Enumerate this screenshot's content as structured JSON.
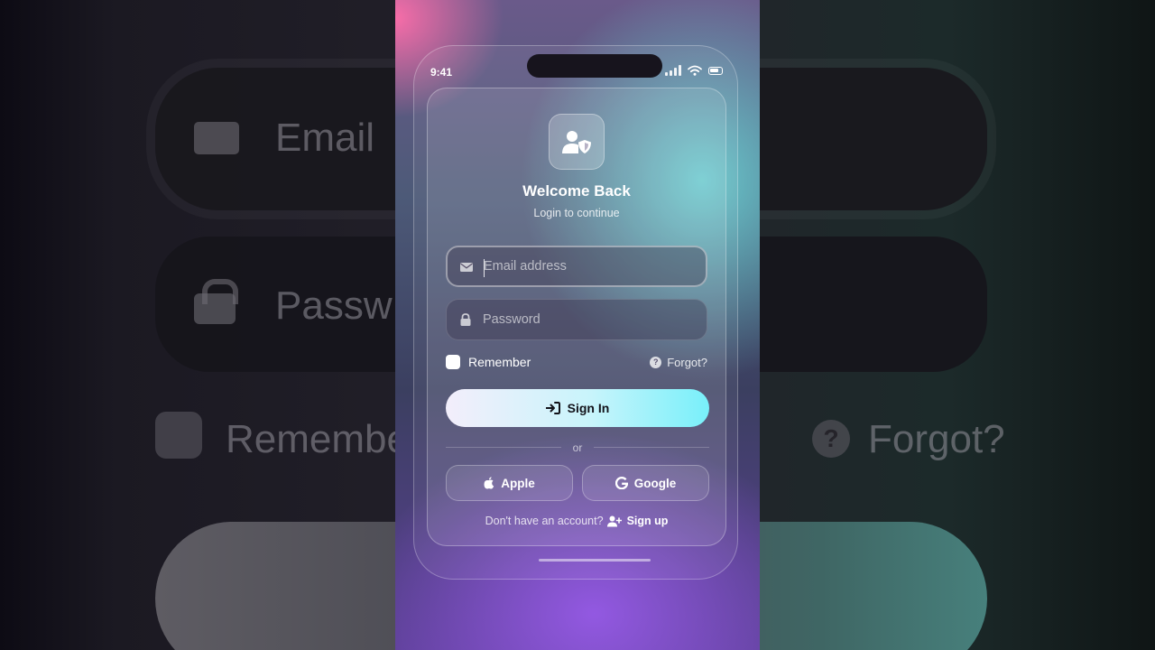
{
  "status_bar": {
    "time": "9:41"
  },
  "login": {
    "title": "Welcome Back",
    "subtitle": "Login to continue",
    "email": {
      "placeholder": "Email address",
      "value": "",
      "icon": "envelope-icon"
    },
    "password": {
      "placeholder": "Password",
      "value": "",
      "icon": "lock-icon"
    },
    "remember_label": "Remember",
    "remember_checked": false,
    "forgot_label": "Forgot?",
    "signin_label": "Sign In",
    "divider_text": "or",
    "social": {
      "apple_label": "Apple",
      "google_label": "Google"
    },
    "footer": {
      "question": "Don't have an account?",
      "signup_label": "Sign up"
    }
  },
  "background": {
    "email_text": "Email",
    "password_text": "Passw",
    "remember_text": "Remembe",
    "forgot_text": "Forgot?"
  },
  "colors": {
    "accent_cyan": "#78f0fa",
    "accent_pink": "#ff6eaa",
    "accent_purple": "#965ae6"
  }
}
